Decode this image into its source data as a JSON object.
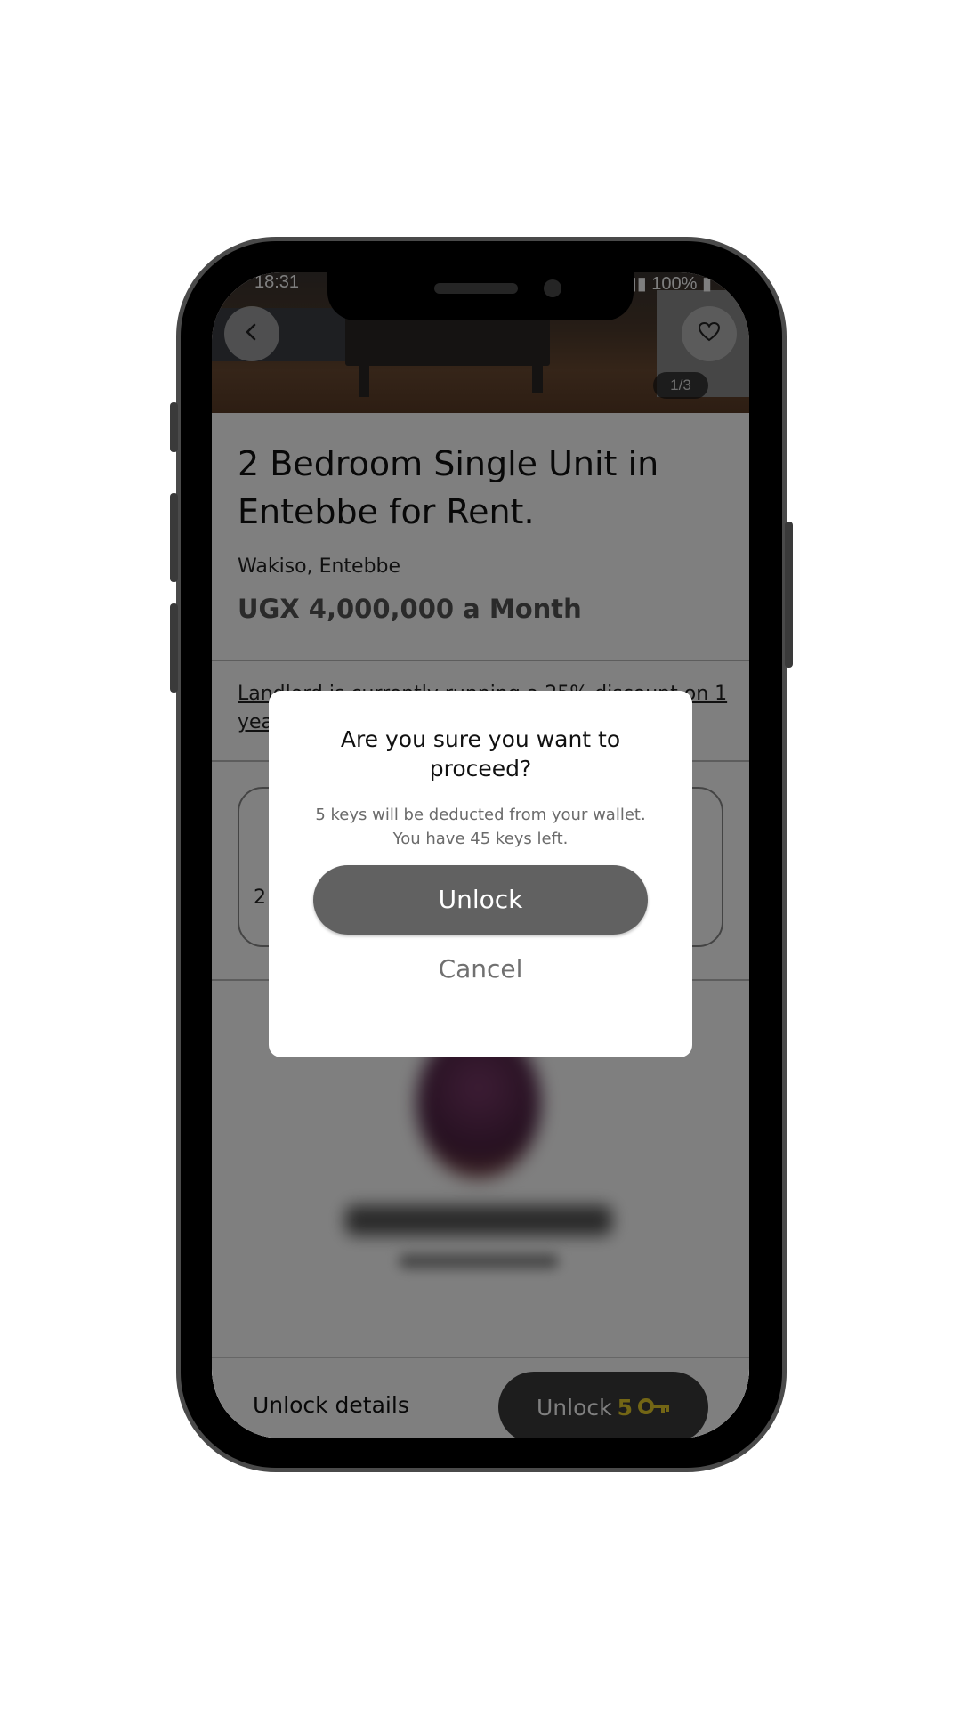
{
  "status_bar": {
    "time": "18:31",
    "battery": "100%"
  },
  "photo": {
    "counter": "1/3"
  },
  "listing": {
    "title": "2 Bedroom Single Unit in Entebbe for Rent.",
    "location": "Wakiso, Entebbe",
    "price": "UGX 4,000,000 a Month",
    "discount": "Landlord is currently running a 25% discount on 1 year",
    "card_number": "2"
  },
  "bottom_bar": {
    "label": "Unlock details",
    "button_label": "Unlock",
    "button_count": "5"
  },
  "dialog": {
    "question": "Are you sure you want to proceed?",
    "message": "5 keys will be deducted from your wallet. You have 45 keys left.",
    "confirm_label": "Unlock",
    "cancel_label": "Cancel"
  },
  "icons": {
    "back": "chevron-left-icon",
    "favorite": "heart-icon",
    "key": "key-icon"
  },
  "colors": {
    "key_accent": "#e6cd2a",
    "dialog_button": "#616161"
  }
}
